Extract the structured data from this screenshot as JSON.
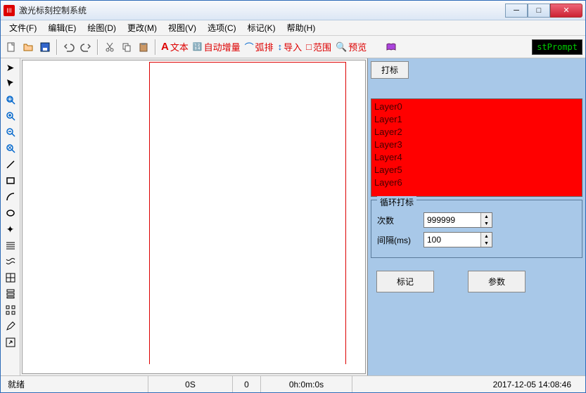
{
  "window": {
    "title": "激光标刻控制系统"
  },
  "menu": {
    "file": "文件(F)",
    "edit": "编辑(E)",
    "draw": "绘图(D)",
    "modify": "更改(M)",
    "view": "视图(V)",
    "option": "选项(C)",
    "mark": "标记(K)",
    "help": "帮助(H)"
  },
  "toolbar": {
    "text": "文本",
    "autoinc": "自动增量",
    "arc": "弧排",
    "import": "导入",
    "range": "范围",
    "preview": "预览",
    "stprompt": "stPrompt"
  },
  "right": {
    "tab": "打标",
    "layers": [
      "Layer0",
      "Layer1",
      "Layer2",
      "Layer3",
      "Layer4",
      "Layer5",
      "Layer6"
    ],
    "loop_title": "循环打标",
    "count_label": "次数",
    "count_value": "999999",
    "interval_label": "间隔(ms)",
    "interval_value": "100",
    "mark_btn": "标记",
    "param_btn": "参数"
  },
  "status": {
    "ready": "就绪",
    "zero_s": "0S",
    "zero": "0",
    "time": "0h:0m:0s",
    "datetime": "2017-12-05 14:08:46"
  }
}
